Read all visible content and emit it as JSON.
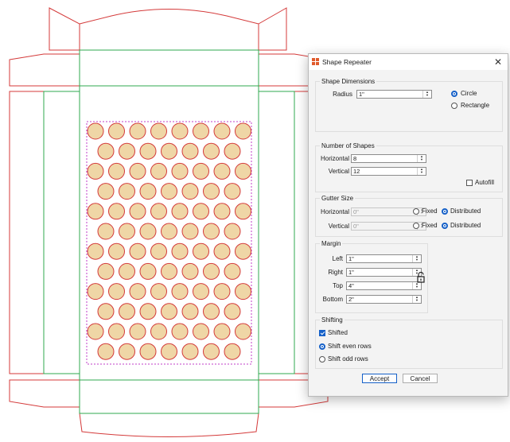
{
  "dialog": {
    "title": "Shape Repeater",
    "close_glyph": "✕",
    "shape_dimensions": {
      "legend": "Shape Dimensions",
      "radius_label": "Radius",
      "radius_value": "1\"",
      "circle_label": "Circle",
      "rectangle_label": "Rectangle",
      "selected_shape": "Circle"
    },
    "number_of_shapes": {
      "legend": "Number of Shapes",
      "horizontal_label": "Horizontal",
      "horizontal_value": "8",
      "vertical_label": "Vertical",
      "vertical_value": "12",
      "autofill_label": "Autofill",
      "autofill_checked": false
    },
    "gutter_size": {
      "legend": "Gutter Size",
      "horizontal_label": "Horizontal",
      "horizontal_value": "0\"",
      "vertical_label": "Vertical",
      "vertical_value": "0\"",
      "fixed_label": "Fixed",
      "distributed_label": "Distributed",
      "horizontal_mode": "Distributed",
      "vertical_mode": "Distributed"
    },
    "margin": {
      "legend": "Margin",
      "left_label": "Left",
      "left_value": "1\"",
      "right_label": "Right",
      "right_value": "1\"",
      "top_label": "Top",
      "top_value": "4\"",
      "bottom_label": "Bottom",
      "bottom_value": "2\"",
      "lock_icon": "unlocked-padlock-icon"
    },
    "shifting": {
      "legend": "Shifting",
      "shifted_label": "Shifted",
      "shifted_checked": true,
      "shift_even_label": "Shift even rows",
      "shift_odd_label": "Shift odd rows",
      "selected": "Shift even rows"
    },
    "accept_label": "Accept",
    "cancel_label": "Cancel"
  },
  "canvas": {
    "dieline_color": "#d43a3a",
    "fold_color": "#2fa84f",
    "layout_border_color": "#c03cc8",
    "shape_fill": "#efd6a6",
    "shape_stroke": "#d43a3a",
    "columns": 8,
    "rows": 12,
    "even_rows_shifted": true
  }
}
